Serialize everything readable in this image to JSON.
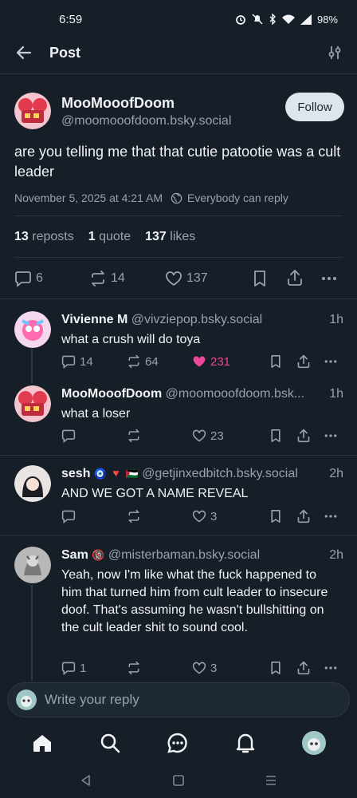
{
  "status_bar": {
    "time": "6:59",
    "battery": "98%"
  },
  "header": {
    "title": "Post"
  },
  "main_post": {
    "display_name": "MooMooofDoom",
    "handle": "@moomooofdoom.bsky.social",
    "follow_label": "Follow",
    "text": "are you telling me that that cutie patootie was a cult leader",
    "timestamp": "November 5, 2025 at 4:21 AM",
    "reply_setting": "Everybody can reply",
    "reposts_count": "13",
    "reposts_label": "reposts",
    "quotes_count": "1",
    "quotes_label": "quote",
    "likes_count": "137",
    "likes_label": "likes",
    "actions": {
      "replies": "6",
      "reposts": "14",
      "likes": "137"
    }
  },
  "replies": [
    {
      "display_name": "Vivienne M",
      "handle": "@vivziepop.bsky.social",
      "time": "1h",
      "text": "what a crush will do toya",
      "replies": "14",
      "reposts": "64",
      "likes": "231",
      "liked": true
    },
    {
      "display_name": "MooMooofDoom",
      "handle": "@moomooofdoom.bsk...",
      "time": "1h",
      "text": "what a loser",
      "replies": "",
      "reposts": "",
      "likes": "23",
      "liked": false
    },
    {
      "display_name": "sesh",
      "display_name_emoji": "🧿 🔻 🇵🇸",
      "handle": "@getjinxedbitch.bsky.social",
      "time": "2h",
      "text": "AND WE GOT A NAME REVEAL",
      "replies": "",
      "reposts": "",
      "likes": "3",
      "liked": false
    },
    {
      "display_name": "Sam",
      "display_name_emoji": "🔞",
      "handle": "@misterbaman.bsky.social",
      "time": "2h",
      "text": "Yeah, now I'm like what the fuck happened to him that turned him from cult leader to insecure doof. That's assuming he wasn't bullshitting on the cult leader shit to sound cool.",
      "replies": "1",
      "reposts": "",
      "likes": "3",
      "liked": false
    }
  ],
  "composer": {
    "placeholder": "Write your reply"
  },
  "colors": {
    "background": "#161e27",
    "like_active": "#ec4899",
    "follow_bg": "#dfe5ec"
  }
}
